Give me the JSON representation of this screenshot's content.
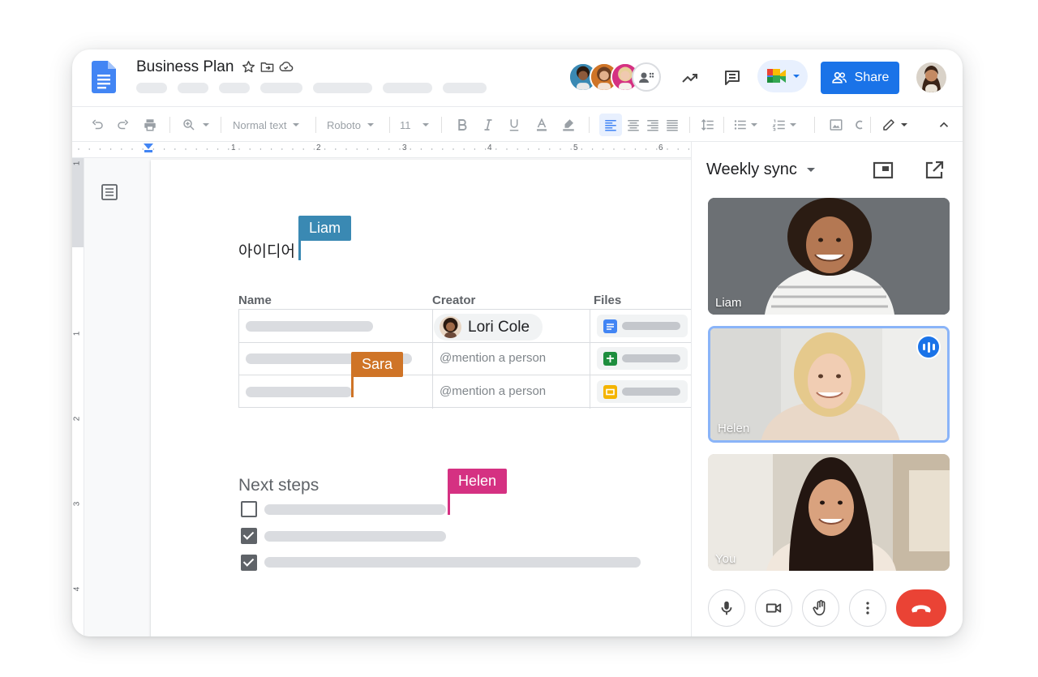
{
  "document": {
    "title": "Business Plan",
    "body_text": "아이디어",
    "table": {
      "headers": [
        "Name",
        "Creator",
        "Files"
      ],
      "creator_chip": "Lori Cole",
      "mention_placeholder_1": "@mention a person",
      "mention_placeholder_2": "@mention a person"
    },
    "next_steps_heading": "Next steps",
    "checklist": [
      {
        "checked": false
      },
      {
        "checked": true
      },
      {
        "checked": true
      }
    ]
  },
  "collaborator_flags": {
    "liam": {
      "label": "Liam",
      "color": "#3a89b3"
    },
    "sara": {
      "label": "Sara",
      "color": "#cf7427"
    },
    "helen": {
      "label": "Helen",
      "color": "#d53182"
    }
  },
  "toolbar": {
    "style_select": "Normal text",
    "font_select": "Roboto",
    "font_size": "11"
  },
  "ruler": {
    "horizontal_marks": [
      "1",
      "2",
      "3",
      "4",
      "5",
      "6"
    ],
    "vertical_marks": [
      "1",
      "1",
      "2",
      "3",
      "4"
    ]
  },
  "header": {
    "share_label": "Share"
  },
  "meet": {
    "title": "Weekly sync",
    "participants": [
      {
        "name": "Liam",
        "speaking": false
      },
      {
        "name": "Helen",
        "speaking": true
      },
      {
        "name": "You",
        "speaking": false
      }
    ]
  },
  "colors": {
    "accent": "#1a73e8",
    "end_call": "#ea4335"
  }
}
